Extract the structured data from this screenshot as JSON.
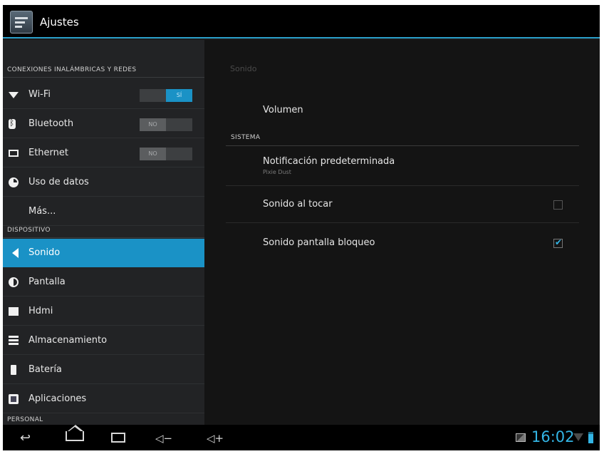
{
  "app": {
    "title": "Ajustes"
  },
  "sidebar": {
    "sections": [
      {
        "header": "CONEXIONES INALÁMBRICAS Y REDES"
      },
      {
        "header": "DISPOSITIVO"
      },
      {
        "header": "PERSONAL"
      }
    ],
    "items": [
      {
        "label": "Wi-Fi",
        "icon": "wifi-icon",
        "toggle": "SÍ",
        "toggle_state": "on"
      },
      {
        "label": "Bluetooth",
        "icon": "bluetooth-icon",
        "toggle": "NO",
        "toggle_state": "off"
      },
      {
        "label": "Ethernet",
        "icon": "ethernet-icon",
        "toggle": "NO",
        "toggle_state": "off"
      },
      {
        "label": "Uso de datos",
        "icon": "data-usage-icon"
      },
      {
        "label": "Más..."
      },
      {
        "label": "Sonido",
        "icon": "sound-icon",
        "selected": true
      },
      {
        "label": "Pantalla",
        "icon": "display-icon"
      },
      {
        "label": "Hdmi",
        "icon": "hdmi-icon"
      },
      {
        "label": "Almacenamiento",
        "icon": "storage-icon"
      },
      {
        "label": "Batería",
        "icon": "battery-icon"
      },
      {
        "label": "Aplicaciones",
        "icon": "apps-icon"
      }
    ]
  },
  "main": {
    "title": "Sonido",
    "volume": "Volumen",
    "system_header": "SISTEMA",
    "rows": [
      {
        "title": "Notificación predeterminada",
        "subtitle": "Pixie Dust"
      },
      {
        "title": "Sonido al tocar",
        "checked": false
      },
      {
        "title": "Sonido pantalla bloqueo",
        "checked": true
      }
    ]
  },
  "navbar": {
    "back_icon": "back-icon",
    "home_icon": "home-icon",
    "recent_icon": "recent-apps-icon",
    "vol_down": "◁−",
    "vol_up": "◁+",
    "clock": "16:02"
  },
  "colors": {
    "accent": "#1a92c6",
    "clock": "#33b5e5"
  }
}
